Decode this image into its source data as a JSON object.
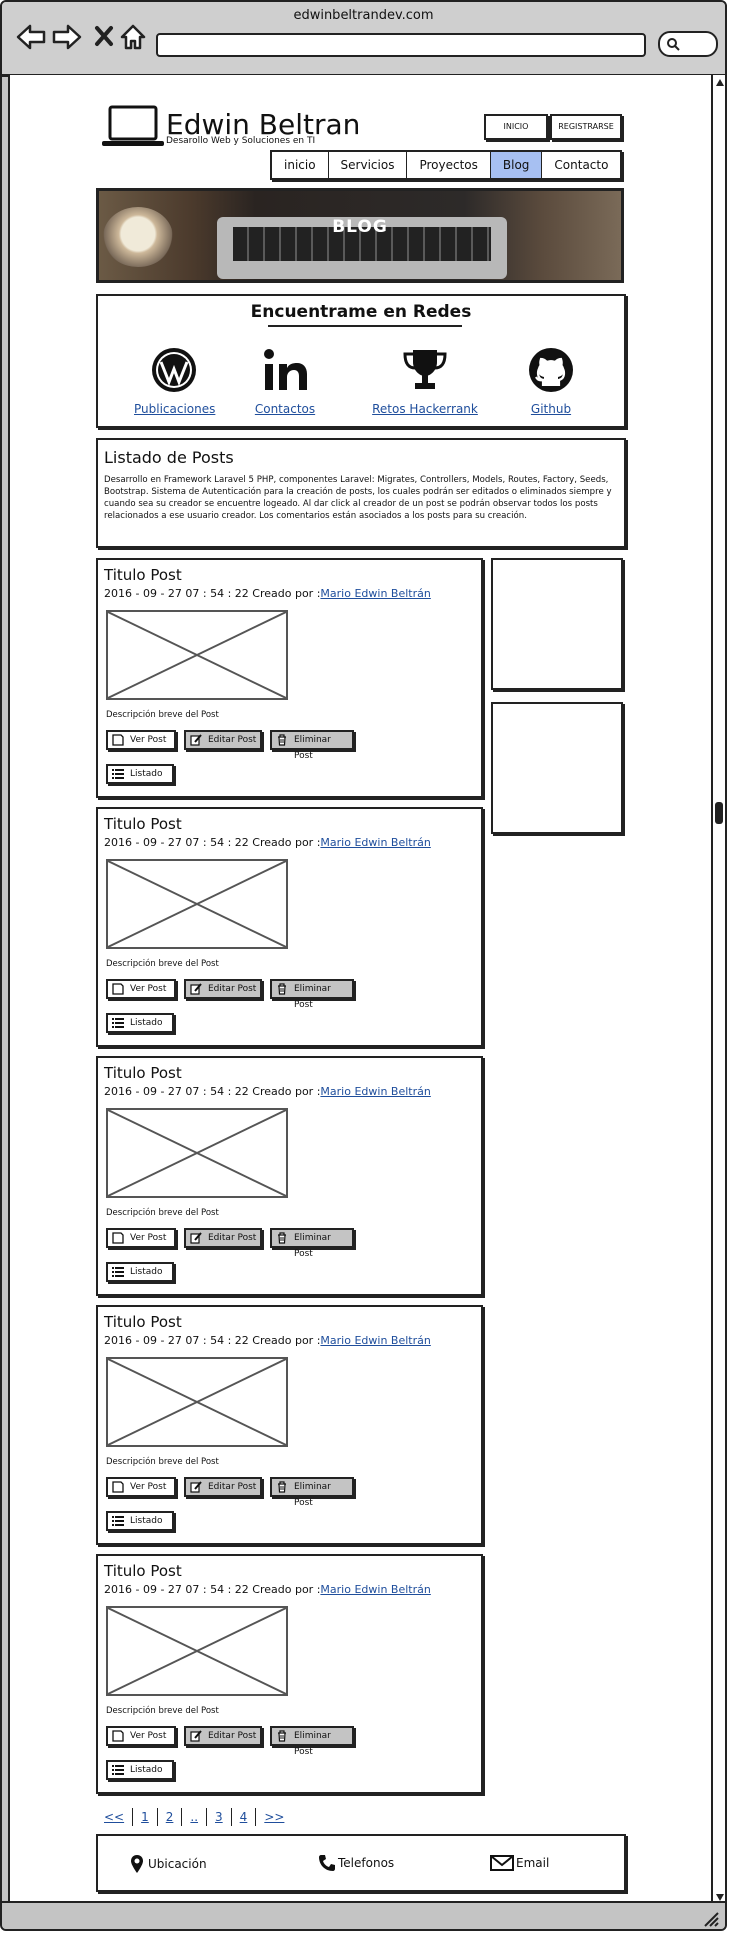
{
  "browser": {
    "url": "edwinbeltrandev.com"
  },
  "header": {
    "title": "Edwin Beltran",
    "subtitle": "Desarollo Web y Soluciones en TI",
    "inicio_button": "INICIO",
    "registrarse_button": "REGISTRARSE"
  },
  "nav": {
    "tabs": [
      {
        "label": "inicio",
        "active": false
      },
      {
        "label": "Servicios",
        "active": false
      },
      {
        "label": "Proyectos",
        "active": false
      },
      {
        "label": "Blog",
        "active": true
      },
      {
        "label": "Contacto",
        "active": false
      }
    ]
  },
  "banner": {
    "title": "BLOG"
  },
  "redes": {
    "title": "Encuentrame en Redes",
    "items": [
      {
        "label": "Publicaciones",
        "icon": "wordpress-icon"
      },
      {
        "label": "Contactos",
        "icon": "linkedin-icon"
      },
      {
        "label": "Retos Hackerrank",
        "icon": "trophy-icon"
      },
      {
        "label": "Github",
        "icon": "github-icon"
      }
    ]
  },
  "listado": {
    "title": "Listado de Posts",
    "text": "Desarrollo en Framework Laravel 5 PHP, componentes Laravel: Migrates, Controllers, Models, Routes, Factory, Seeds, Bootstrap. Sistema de Autenticación para la creación de posts, los cuales podrán ser editados o eliminados siempre y cuando sea su creador se encuentre logeado. Al dar click al creador de un post se podrán observar todos los posts relacionados a ese usuario creador. Los comentarios están asociados a los posts para su creación."
  },
  "posts": [
    {
      "title": "Titulo Post",
      "meta": "2016 - 09 - 27 07 : 54 : 22 Creado por :",
      "author": "Mario Edwin Beltrán",
      "desc": "Descripción breve del Post",
      "ver": "Ver Post",
      "editar": "Editar Post",
      "eliminar": "Eliminar Post",
      "listado": "Listado"
    },
    {
      "title": "Titulo Post",
      "meta": "2016 - 09 - 27 07 : 54 : 22 Creado por :",
      "author": "Mario Edwin Beltrán",
      "desc": "Descripción breve del Post",
      "ver": "Ver Post",
      "editar": "Editar Post",
      "eliminar": "Eliminar Post",
      "listado": "Listado"
    },
    {
      "title": "Titulo Post",
      "meta": "2016 - 09 - 27 07 : 54 : 22 Creado por :",
      "author": "Mario Edwin Beltrán",
      "desc": "Descripción breve del Post",
      "ver": "Ver Post",
      "editar": "Editar Post",
      "eliminar": "Eliminar Post",
      "listado": "Listado"
    },
    {
      "title": "Titulo Post",
      "meta": "2016 - 09 - 27 07 : 54 : 22 Creado por :",
      "author": "Mario Edwin Beltrán",
      "desc": "Descripción breve del Post",
      "ver": "Ver Post",
      "editar": "Editar Post",
      "eliminar": "Eliminar Post",
      "listado": "Listado"
    },
    {
      "title": "Titulo Post",
      "meta": "2016 - 09 - 27 07 : 54 : 22 Creado por :",
      "author": "Mario Edwin Beltrán",
      "desc": "Descripción breve del Post",
      "ver": "Ver Post",
      "editar": "Editar Post",
      "eliminar": "Eliminar Post",
      "listado": "Listado"
    }
  ],
  "pagination": [
    "<<",
    "1",
    "2",
    "..",
    "3",
    "4",
    ">>"
  ],
  "footer": {
    "ubicacion": "Ubicación",
    "telefonos": "Telefonos",
    "email": "Email"
  },
  "colors": {
    "active_tab": "#a7c0f2",
    "link": "#1f4e9c",
    "chrome": "#c4c4c4"
  }
}
